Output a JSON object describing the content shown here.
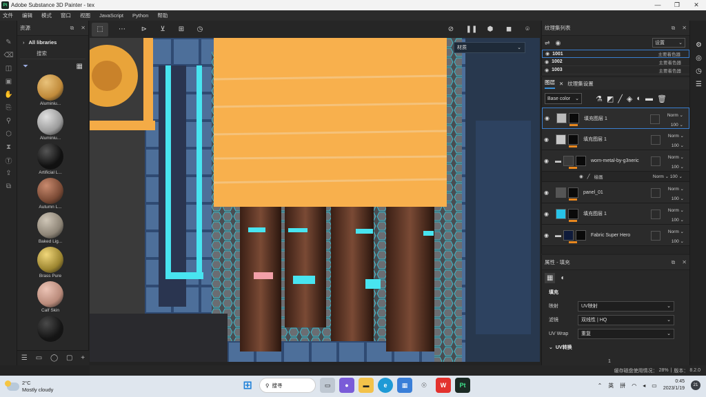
{
  "app": {
    "title": "Adobe Substance 3D Painter - tex",
    "logo": "Pt",
    "window_controls": [
      "—",
      "❐",
      "✕"
    ]
  },
  "menu": [
    "文件",
    "编辑",
    "模式",
    "窗口",
    "视图",
    "JavaScript",
    "Python",
    "帮助"
  ],
  "left_tools": [
    "brush-icon",
    "eraser-icon",
    "projection-icon",
    "geometry-mask-icon",
    "smudge-icon",
    "clone-icon",
    "picker-icon",
    "polyfill-icon",
    "bake-icon",
    "text-icon",
    "export-icon",
    "share-icon"
  ],
  "assets": {
    "title": "资源",
    "library": "All libraries",
    "search_placeholder": "搜索",
    "materials": [
      {
        "name": "Aluminiu...",
        "color": "#c08a3a",
        "hi": "#e9c27a"
      },
      {
        "name": "Aluminiu...",
        "color": "#9a9a9a",
        "hi": "#e0e0e0"
      },
      {
        "name": "Artificial L...",
        "color": "#111111",
        "hi": "#555555"
      },
      {
        "name": "Autumn L...",
        "color": "#7a4a35",
        "hi": "#c98a6e"
      },
      {
        "name": "Baked Lig...",
        "color": "#8d8476",
        "hi": "#cfc6b7"
      },
      {
        "name": "Brass Pure",
        "color": "#9c8530",
        "hi": "#f1d77a"
      },
      {
        "name": "Calf Skin",
        "color": "#b98a7a",
        "hi": "#ecc4b6"
      },
      {
        "name": "",
        "color": "#151515",
        "hi": "#4a4a4a"
      }
    ]
  },
  "viewport": {
    "material_dropdown": "材质"
  },
  "texture_sets": {
    "title": "纹理集列表",
    "settings": "设置",
    "rows": [
      {
        "id": "1001",
        "shader": "主要着色器"
      },
      {
        "id": "1002",
        "shader": "主要着色器"
      },
      {
        "id": "1003",
        "shader": "主要着色器"
      }
    ]
  },
  "layers": {
    "tab1": "图层",
    "tab2": "纹理集设置",
    "channel": "Base color",
    "items": [
      {
        "name": "填充图层 1",
        "blend": "Norm",
        "opacity": "100",
        "thumb": "#bbbbbb",
        "selected": true
      },
      {
        "name": "填充图层 1",
        "blend": "Norm",
        "opacity": "100",
        "thumb": "#c8c8c8",
        "selected": false
      },
      {
        "name": "worn-metal-by-g3neric",
        "blend": "Norm",
        "opacity": "100",
        "thumb": "#3a3a3a",
        "selected": false,
        "folder": true
      },
      {
        "name": "panel_01",
        "blend": "Norm",
        "opacity": "100",
        "thumb": "#555555",
        "selected": false
      },
      {
        "name": "填充图层 1",
        "blend": "Norm",
        "opacity": "100",
        "thumb": "#27c3e8",
        "selected": false
      },
      {
        "name": "Fabric Super Hero",
        "blend": "Norm",
        "opacity": "100",
        "thumb": "#0e1a3a",
        "selected": false,
        "folder": true
      }
    ],
    "sub_effect": {
      "name": "绘画",
      "blend": "Norm",
      "opacity": "100"
    }
  },
  "properties": {
    "title": "属性 - 填充",
    "section": "填充",
    "rows": [
      {
        "k": "映射",
        "v": "UV映射"
      },
      {
        "k": "滤镜",
        "v": "双线性 | HQ"
      },
      {
        "k": "UV Wrap",
        "v": "重复"
      }
    ],
    "uv": "UV转换",
    "uv_value": "1"
  },
  "status": {
    "cache": "缓存磁盘使用情况：",
    "percent": "28%",
    "version_label": "版本：",
    "version": "8.2.0"
  },
  "taskbar": {
    "temp": "2°C",
    "weather": "Mostly cloudy",
    "search": "搜寻",
    "time": "0:45",
    "date": "2023/1/19",
    "ime1": "英",
    "ime2": "拼",
    "badge": "21"
  }
}
